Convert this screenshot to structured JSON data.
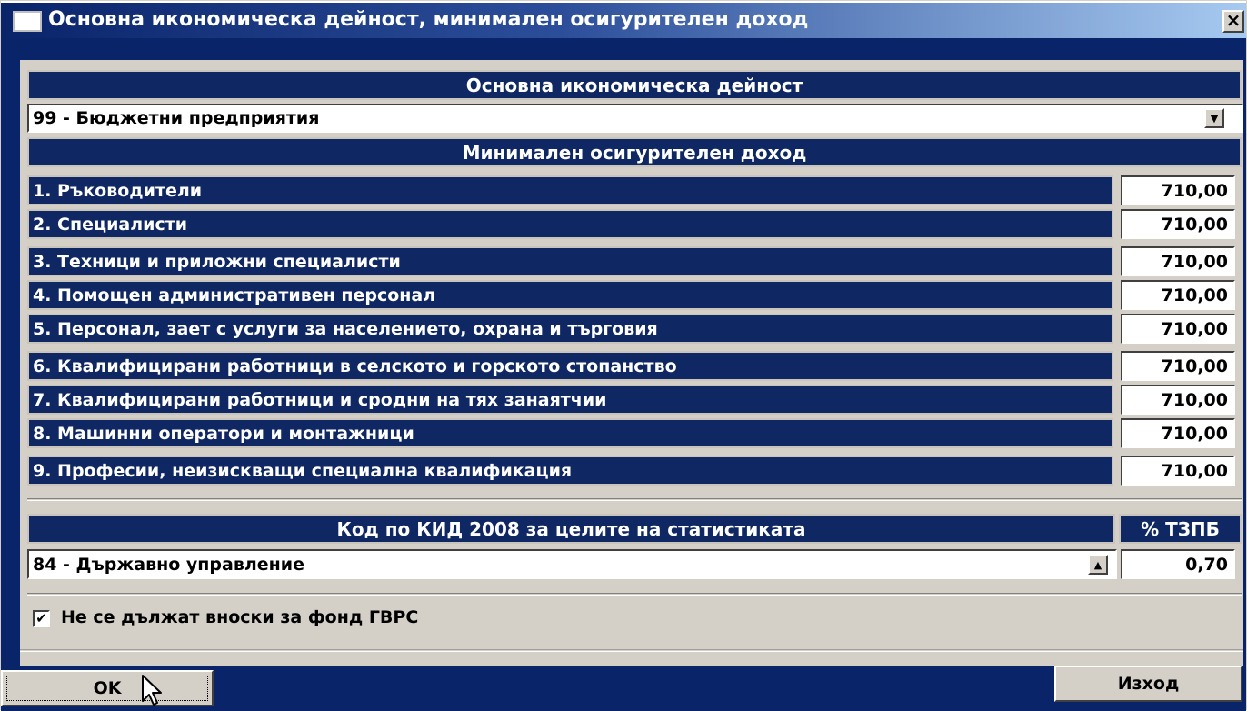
{
  "window": {
    "title": "Основна икономическа дейност, минимален осигурителен доход",
    "close_label": "×"
  },
  "activity": {
    "header": "Основна икономическа дейност",
    "selected": "99 - Бюджетни предприятия"
  },
  "min_income": {
    "header": "Минимален осигурителен доход",
    "rows": [
      {
        "label": "1. Ръководители",
        "value": "710,00"
      },
      {
        "label": "2. Специалисти",
        "value": "710,00"
      },
      {
        "label": "3. Техници и приложни специалисти",
        "value": "710,00"
      },
      {
        "label": "4. Помощен административен персонал",
        "value": "710,00"
      },
      {
        "label": "5. Персонал, зает с услуги за населението, охрана и търговия",
        "value": "710,00"
      },
      {
        "label": "6. Квалифицирани работници в селското и горското стопанство",
        "value": "710,00"
      },
      {
        "label": "7. Квалифицирани работници и сродни на тях занаятчии",
        "value": "710,00"
      },
      {
        "label": "8. Машинни оператори и монтажници",
        "value": "710,00"
      },
      {
        "label": "9. Професии, неизискващи специална квалификация",
        "value": "710,00"
      }
    ]
  },
  "kid": {
    "header": "Код по КИД 2008 за целите на статистиката",
    "rate_header": "% ТЗПБ",
    "selected": "84 - Държавно управление",
    "rate_value": "0,70"
  },
  "gvrs": {
    "checked": true,
    "label": "Не се дължат вноски за фонд ГВРС"
  },
  "buttons": {
    "ok": "OK",
    "exit": "Изход"
  },
  "icons": {
    "dropdown": "chevron-down-icon",
    "dropup": "chevron-up-icon",
    "check": "check-icon",
    "cursor": "mouse-pointer-icon"
  }
}
